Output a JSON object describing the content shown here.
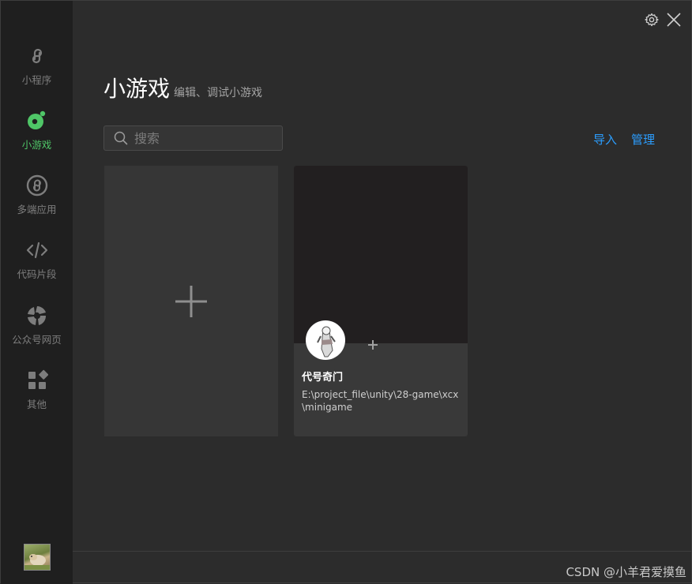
{
  "sidebar": {
    "items": [
      {
        "label": "小程序",
        "icon": "miniprogram-icon",
        "active": false
      },
      {
        "label": "小游戏",
        "icon": "minigame-icon",
        "active": true
      },
      {
        "label": "多端应用",
        "icon": "multiplatform-icon",
        "active": false
      },
      {
        "label": "代码片段",
        "icon": "code-snippet-icon",
        "active": false
      },
      {
        "label": "公众号网页",
        "icon": "official-account-icon",
        "active": false
      },
      {
        "label": "其他",
        "icon": "others-icon",
        "active": false
      }
    ]
  },
  "header": {
    "title": "小游戏",
    "subtitle": "编辑、调试小游戏"
  },
  "search": {
    "placeholder": "搜索"
  },
  "actions": {
    "import_label": "导入",
    "manage_label": "管理"
  },
  "projects": [
    {
      "name": "代号奇门",
      "path": "E:\\project_file\\unity\\28-game\\xcx\\minigame"
    }
  ],
  "watermark": "CSDN @小羊君爱摸鱼",
  "colors": {
    "accent_green": "#4fc667",
    "link_blue": "#2b9eff",
    "sidebar_bg": "#1f1f1f",
    "main_bg": "#2c2c2c"
  }
}
